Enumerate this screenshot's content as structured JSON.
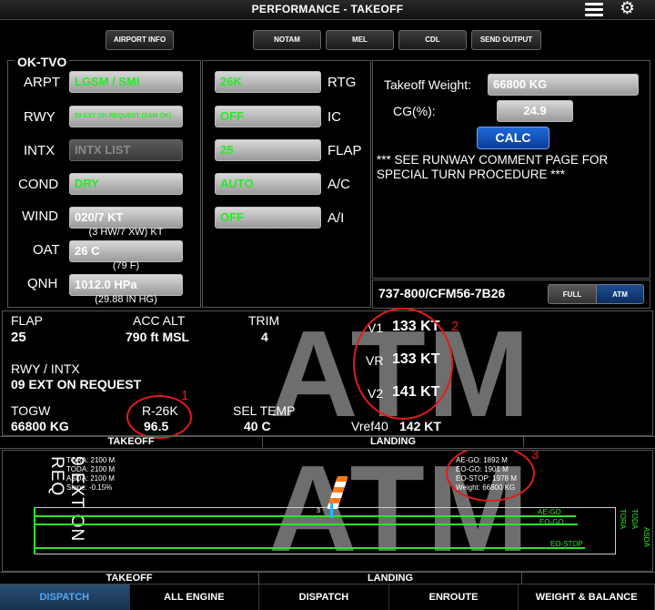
{
  "header": {
    "title": "PERFORMANCE - TAKEOFF",
    "menu_icon": "hamburger-icon",
    "settings_icon": "gear-icon"
  },
  "toolbar": {
    "airport_info": "AIRPORT INFO",
    "notam": "NOTAM",
    "mel": "MEL",
    "cdl": "CDL",
    "send_output": "SEND OUTPUT"
  },
  "aircraft": {
    "registration": "OK-TVO",
    "type": "737-800/CFM56-7B26"
  },
  "inputs": {
    "arpt_label": "ARPT",
    "arpt": "LGSM / SMI",
    "rwy_label": "RWY",
    "rwy": "09 EXT ON REQUEST (SAM OK)",
    "intx_label": "INTX",
    "intx": "INTX LIST",
    "cond_label": "COND",
    "cond": "DRY",
    "wind_label": "WIND",
    "wind": "020/7 KT",
    "wind_sub": "(3 HW/7 XW) KT",
    "oat_label": "OAT",
    "oat": "26 C",
    "oat_sub": "(79 F)",
    "qnh_label": "QNH",
    "qnh": "1012.0 HPa",
    "qnh_sub": "(29.88 IN HG)"
  },
  "config": {
    "rtg": "26K",
    "rtg_label": "RTG",
    "ic": "OFF",
    "ic_label": "IC",
    "flap": "25",
    "flap_label": "FLAP",
    "ac": "AUTO",
    "ac_label": "A/C",
    "ai": "OFF",
    "ai_label": "A/I"
  },
  "weight": {
    "tow_label": "Takeoff Weight:",
    "tow": "66800 KG",
    "cg_label": "CG(%):",
    "cg": "24.9",
    "calc": "CALC",
    "comment": "*** SEE RUNWAY COMMENT PAGE FOR SPECIAL TURN PROCEDURE ***"
  },
  "mode": {
    "full": "FULL",
    "atm": "ATM",
    "selected": "ATM"
  },
  "results": {
    "watermark": "ATM",
    "flap_label": "FLAP",
    "flap": "25",
    "acc_alt_label": "ACC ALT",
    "acc_alt": "790 ft MSL",
    "trim_label": "TRIM",
    "trim": "4",
    "v1_label": "V1",
    "v1": "133 KT",
    "vr_label": "VR",
    "vr": "133 KT",
    "v2_label": "V2",
    "v2": "141 KT",
    "rwy_intx_label": "RWY / INTX",
    "rwy_intx": "09 EXT ON REQUEST",
    "togw_label": "TOGW",
    "togw": "66800 KG",
    "rating_label": "R-26K",
    "rating": "96.5",
    "sel_temp_label": "SEL TEMP",
    "sel_temp": "40 C",
    "vref_label": "Vref40",
    "vref": "142 KT",
    "annotation_1": "1",
    "annotation_2": "2",
    "annotation_3": "3"
  },
  "section_tabs": {
    "takeoff": "TAKEOFF",
    "landing": "LANDING"
  },
  "runway": {
    "vertical_text": "9 EXT ON REQ",
    "tora": "TORA: 2100 M",
    "toda": "TODA: 2100 M",
    "asda": "ASDA: 2100 M",
    "slope": "Slope: -0.15%",
    "ae_go": "AE-GO: 1892 M",
    "eo_go": "EO-GO: 1901 M",
    "eo_stop": "EO-STOP: 1978 M",
    "weight": "Weight: 66800 KG",
    "line_ae_go": "AE-GO",
    "line_eo_go": "EO-GO",
    "line_eo_stop": "EO-STOP",
    "end_tora": "TORA",
    "end_toda": "TODA",
    "end_asda": "ASDA",
    "marker": "3",
    "watermark": "ATM"
  },
  "bottom_nav": {
    "tab1": "DISPATCH",
    "tab2": "ALL ENGINE",
    "tab3": "DISPATCH",
    "tab4": "ENROUTE",
    "tab5": "WEIGHT & BALANCE",
    "active": "DISPATCH"
  },
  "colors": {
    "green": "#29e829",
    "blue": "#1f6ad8",
    "red": "#e31b1b"
  }
}
